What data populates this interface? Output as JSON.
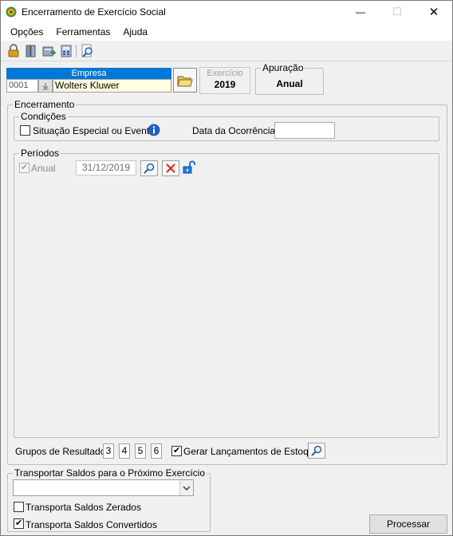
{
  "window": {
    "title": "Encerramento de Exercício Social",
    "minimize": "—",
    "maximize": "☐",
    "close": "✕"
  },
  "menu": [
    "Opções",
    "Ferramentas",
    "Ajuda"
  ],
  "toolbar": {
    "icons": [
      "lock-icon",
      "book-icon",
      "export-icon",
      "calculator-icon",
      "search-icon"
    ]
  },
  "empresa": {
    "label": "Empresa",
    "code": "0001",
    "name": "Wolters Kluwer"
  },
  "exercicio": {
    "label": "Exercício",
    "value": "2019"
  },
  "apuracao": {
    "label": "Apuração",
    "value": "Anual"
  },
  "encerramento": {
    "label": "Encerramento",
    "condicoes": {
      "label": "Condições",
      "situacao_label": "Situação Especial ou Evento",
      "data_ocorrencia_label": "Data da Ocorrência:",
      "data_ocorrencia_value": ""
    },
    "periodos": {
      "label": "Períodos",
      "anual_label": "Anual",
      "anual_checked": true,
      "date": "31/12/2019"
    },
    "grupos": {
      "label": "Grupos de Resultado:",
      "values": [
        "3",
        "4",
        "5",
        "6"
      ]
    },
    "gerar_label": "Gerar Lançamentos de Estoque",
    "gerar_checked": true
  },
  "transportar": {
    "label": "Transportar Saldos para o Próximo Exercício",
    "selected": "",
    "zerados_label": "Transporta Saldos Zerados",
    "zerados_checked": false,
    "convertidos_label": "Transporta Saldos Convertidos",
    "convertidos_checked": true
  },
  "process_button": "Processar",
  "colors": {
    "accent": "#0078d7",
    "highlight_field": "#ffffe1",
    "delete_red": "#e02020"
  }
}
